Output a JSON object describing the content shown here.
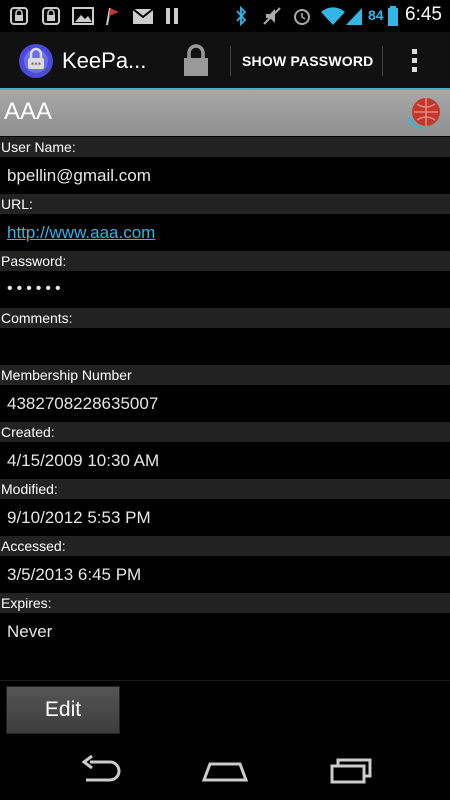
{
  "status_bar": {
    "time": "6:45",
    "battery_level": "84",
    "icons": [
      "lock-icon",
      "lock-icon",
      "image-icon",
      "flag-icon",
      "gmail-icon",
      "pause-icon",
      "bluetooth-icon",
      "muted-icon",
      "alarm-icon",
      "wifi-icon",
      "signal-icon"
    ]
  },
  "action_bar": {
    "app_title": "KeePa...",
    "show_password_label": "SHOW PASSWORD",
    "accent_color": "#33b5e5"
  },
  "entry": {
    "title": "AAA",
    "fields": [
      {
        "label": "User Name:",
        "value": "bpellin@gmail.com"
      },
      {
        "label": "URL:",
        "value": "http://www.aaa.com"
      },
      {
        "label": "Password:",
        "value": "••••••"
      },
      {
        "label": "Comments:",
        "value": ""
      },
      {
        "label": "Membership Number",
        "value": "4382708228635007"
      },
      {
        "label": "Created:",
        "value": "4/15/2009 10:30 AM"
      },
      {
        "label": "Modified:",
        "value": "9/10/2012 5:53 PM"
      },
      {
        "label": "Accessed:",
        "value": "3/5/2013 6:45 PM"
      },
      {
        "label": "Expires:",
        "value": "Never"
      }
    ]
  },
  "edit_button_label": "Edit",
  "nav_bar": {
    "icons": [
      "back-icon",
      "home-icon",
      "recent-apps-icon"
    ]
  }
}
